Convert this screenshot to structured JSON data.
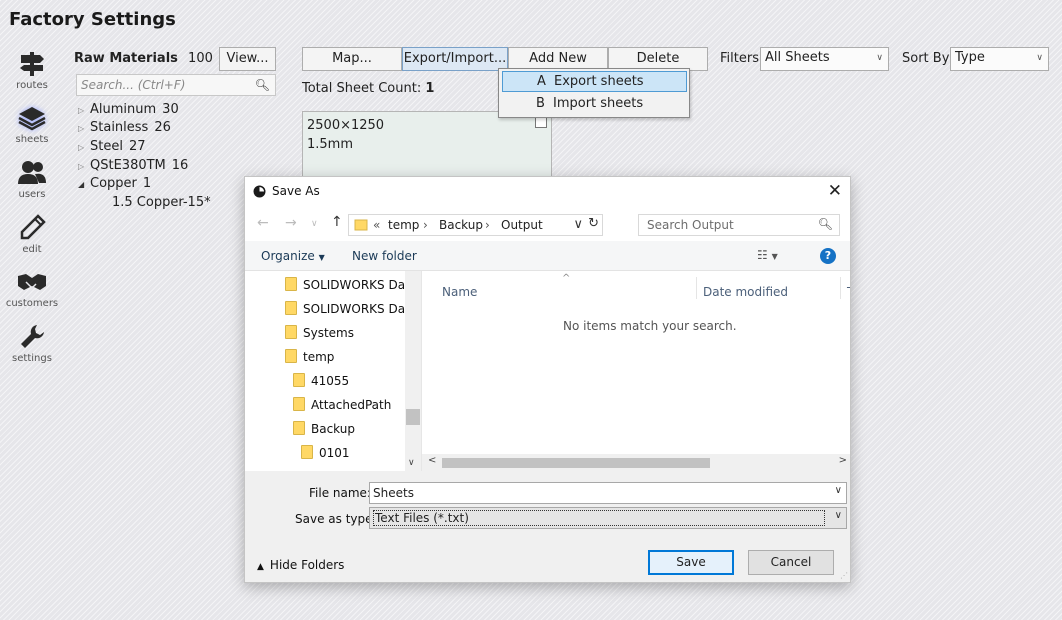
{
  "app": {
    "title": "Factory Settings"
  },
  "nav": [
    {
      "label": "routes",
      "icon": "signpost-icon"
    },
    {
      "label": "sheets",
      "icon": "layers-icon"
    },
    {
      "label": "users",
      "icon": "users-icon"
    },
    {
      "label": "edit",
      "icon": "pencil-icon"
    },
    {
      "label": "customers",
      "icon": "handshake-icon"
    },
    {
      "label": "settings",
      "icon": "wrench-icon"
    }
  ],
  "raw_materials": {
    "title": "Raw Materials",
    "count": "100",
    "view_button": "View...",
    "search_placeholder": "Search... (Ctrl+F)",
    "tree": [
      {
        "name": "Aluminum",
        "count": "30",
        "expanded": false
      },
      {
        "name": "Stainless",
        "count": "26",
        "expanded": false
      },
      {
        "name": "Steel",
        "count": "27",
        "expanded": false
      },
      {
        "name": "QStE380TM",
        "count": "16",
        "expanded": false
      },
      {
        "name": "Copper",
        "count": "1",
        "expanded": true
      }
    ],
    "child": "1.5 Copper-15*"
  },
  "toolbar": {
    "map": "Map...",
    "export_import": "Export/Import...",
    "add_new": "Add New",
    "delete": "Delete",
    "filters_label": "Filters",
    "filters_value": "All Sheets",
    "sortby_label": "Sort By",
    "sortby_value": "Type"
  },
  "total": {
    "label": "Total Sheet Count:",
    "value": "1"
  },
  "sheet_card": {
    "size": "2500×1250",
    "thickness": "1.5mm"
  },
  "popup_menu": [
    {
      "key": "A",
      "label": "Export sheets",
      "highlighted": true
    },
    {
      "key": "B",
      "label": "Import sheets",
      "highlighted": false
    }
  ],
  "dialog": {
    "title": "Save As",
    "address": {
      "prefix": "«",
      "segments": [
        "temp",
        "Backup",
        "Output"
      ]
    },
    "search_placeholder": "Search Output",
    "organize": "Organize",
    "new_folder": "New folder",
    "folders": [
      "SOLIDWORKS Data",
      "SOLIDWORKS Data",
      "Systems",
      "temp",
      "41055",
      "AttachedPath",
      "Backup",
      "0101"
    ],
    "columns": {
      "name": "Name",
      "date": "Date modified",
      "type": "T"
    },
    "empty_message": "No items match your search.",
    "file_name_label": "File name:",
    "file_name_value": "Sheets",
    "save_type_label": "Save as type:",
    "save_type_value": "Text Files (*.txt)",
    "hide_folders": "Hide Folders",
    "save": "Save",
    "cancel": "Cancel"
  }
}
